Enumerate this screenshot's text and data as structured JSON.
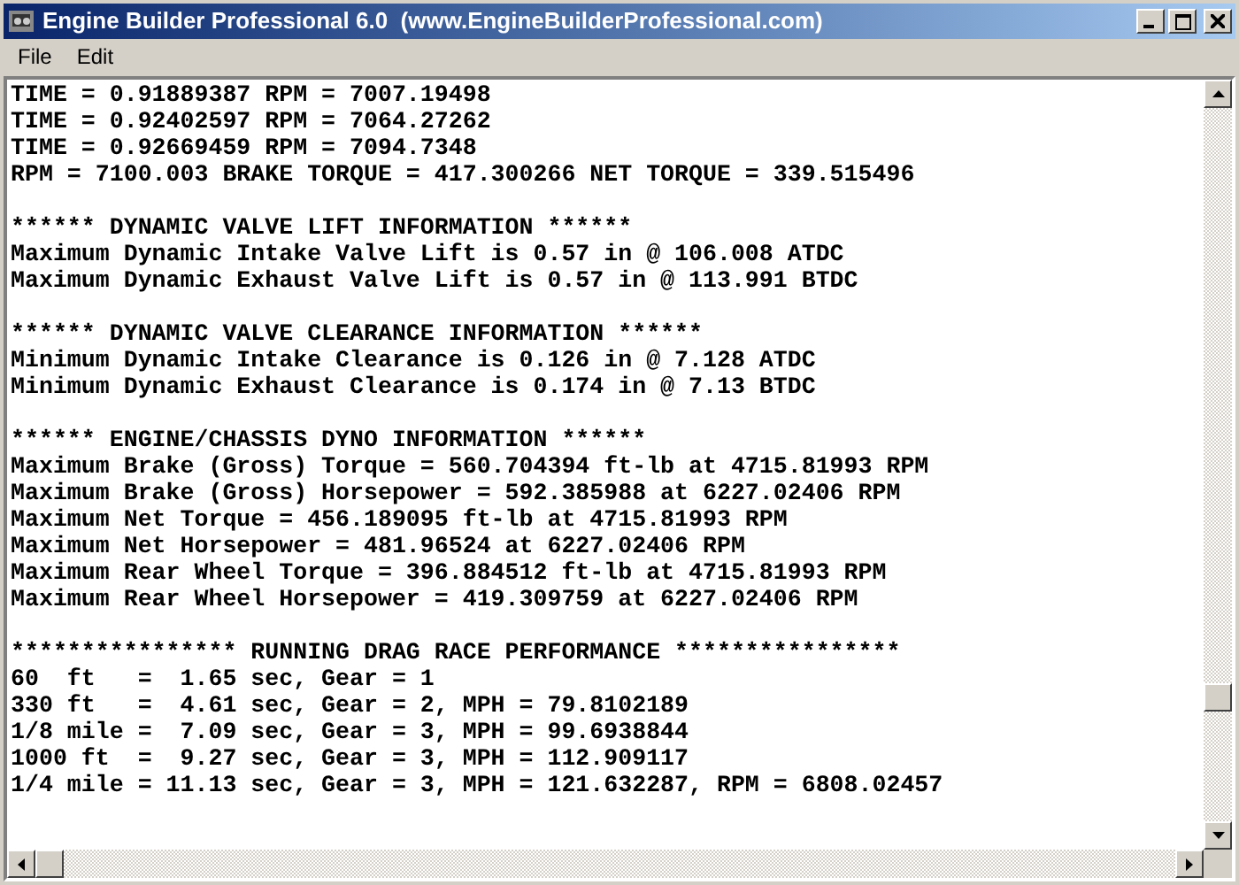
{
  "window": {
    "title": "Engine Builder Professional 6.0  (www.EngineBuilderProfessional.com)"
  },
  "menu": [
    "File",
    "Edit"
  ],
  "output": [
    {
      "lines": [
        "TIME = 0.91889387 RPM = 7007.19498",
        "TIME = 0.92402597 RPM = 7064.27262",
        "TIME = 0.92669459 RPM = 7094.7348",
        "RPM = 7100.003 BRAKE TORQUE = 417.300266 NET TORQUE = 339.515496"
      ]
    },
    {
      "lines": [
        "****** DYNAMIC VALVE LIFT INFORMATION ******",
        "Maximum Dynamic Intake Valve Lift is 0.57 in @ 106.008 ATDC",
        "Maximum Dynamic Exhaust Valve Lift is 0.57 in @ 113.991 BTDC"
      ]
    },
    {
      "lines": [
        "****** DYNAMIC VALVE CLEARANCE INFORMATION ******",
        "Minimum Dynamic Intake Clearance is 0.126 in @ 7.128 ATDC",
        "Minimum Dynamic Exhaust Clearance is 0.174 in @ 7.13 BTDC"
      ]
    },
    {
      "lines": [
        "****** ENGINE/CHASSIS DYNO INFORMATION ******",
        "Maximum Brake (Gross) Torque = 560.704394 ft-lb at 4715.81993 RPM",
        "Maximum Brake (Gross) Horsepower = 592.385988 at 6227.02406 RPM",
        "Maximum Net Torque = 456.189095 ft-lb at 4715.81993 RPM",
        "Maximum Net Horsepower = 481.96524 at 6227.02406 RPM",
        "Maximum Rear Wheel Torque = 396.884512 ft-lb at 4715.81993 RPM",
        "Maximum Rear Wheel Horsepower = 419.309759 at 6227.02406 RPM"
      ]
    },
    {
      "lines": [
        "**************** RUNNING DRAG RACE PERFORMANCE ****************",
        "60  ft   =  1.65 sec, Gear = 1",
        "330 ft   =  4.61 sec, Gear = 2, MPH = 79.8102189",
        "1/8 mile =  7.09 sec, Gear = 3, MPH = 99.6938844",
        "1000 ft  =  9.27 sec, Gear = 3, MPH = 112.909117",
        "1/4 mile = 11.13 sec, Gear = 3, MPH = 121.632287, RPM = 6808.02457"
      ]
    }
  ]
}
